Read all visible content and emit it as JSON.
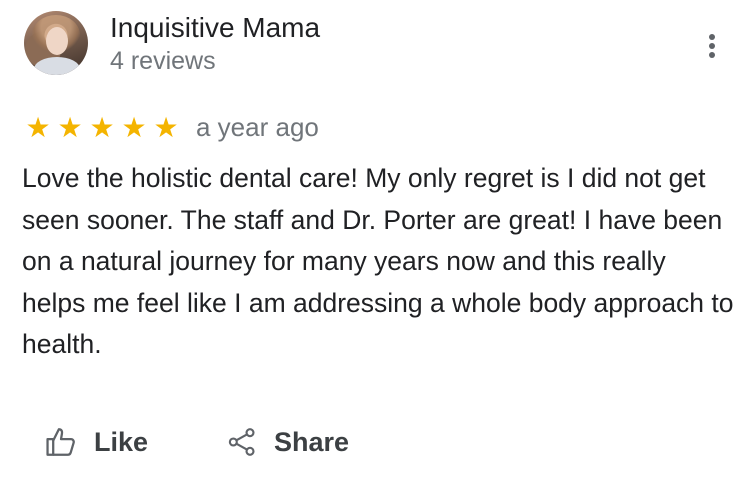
{
  "review": {
    "author": {
      "name": "Inquisitive Mama",
      "review_count": "4 reviews",
      "avatar_icon": "user-avatar"
    },
    "more_icon": "more-vertical-icon",
    "rating": {
      "value": 5,
      "max": 5,
      "star_color": "#f4b400"
    },
    "time": "a year ago",
    "text": "Love the holistic dental care! My only regret is I did not get seen sooner. The staff and Dr. Porter are great! I have been on a natural journey for many years now and this really helps me feel like I am addressing a whole body approach to health.",
    "actions": {
      "like_label": "Like",
      "like_icon": "thumbs-up-icon",
      "share_label": "Share",
      "share_icon": "share-icon"
    }
  }
}
